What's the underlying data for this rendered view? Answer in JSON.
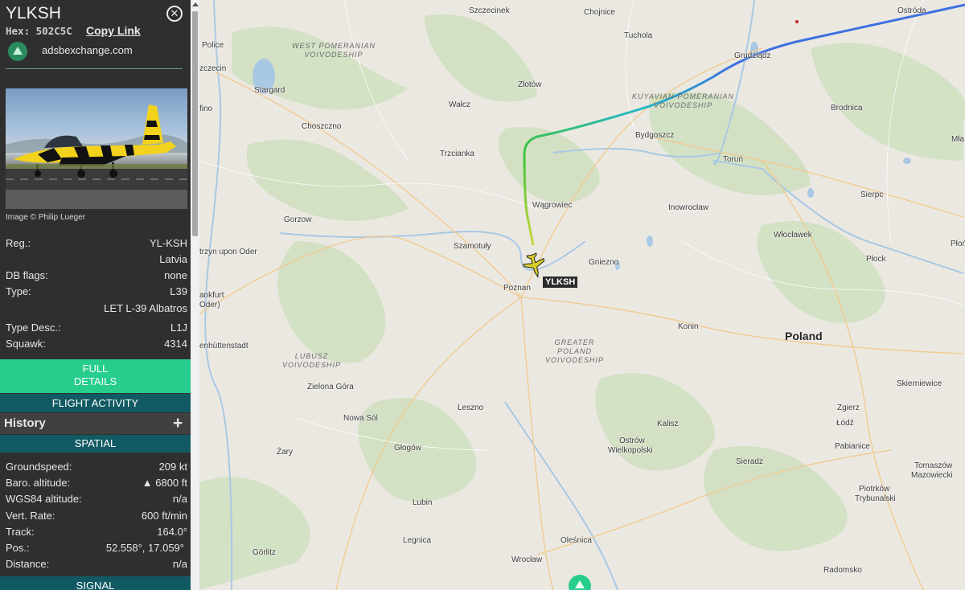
{
  "sidebar": {
    "title": "YLKSH",
    "hex_label": "Hex:",
    "hex_value": "502C5C",
    "copy_link": "Copy Link",
    "source_link": "adsbexchange.com",
    "photo_credit": "Image © Philip Lueger",
    "info": {
      "reg_label": "Reg.:",
      "reg_value": "YL-KSH",
      "country": "Latvia",
      "dbflags_label": "DB flags:",
      "dbflags_value": "none",
      "type_label": "Type:",
      "type_value": "L39",
      "type_full": "LET L-39 Albatros",
      "typedesc_label": "Type Desc.:",
      "typedesc_value": "L1J",
      "squawk_label": "Squawk:",
      "squawk_value": "4314"
    },
    "full_details_line1": "FULL",
    "full_details_line2": "DETAILS",
    "flight_activity": "FLIGHT ACTIVITY",
    "history": "History",
    "history_toggle": "+",
    "spatial_header": "SPATIAL",
    "spatial": {
      "groundspeed_label": "Groundspeed:",
      "groundspeed_value": "209 kt",
      "baro_label": "Baro. altitude:",
      "baro_value": "▲ 6800 ft",
      "wgs_label": "WGS84 altitude:",
      "wgs_value": "n/a",
      "vrate_label": "Vert. Rate:",
      "vrate_value": "600 ft/min",
      "track_label": "Track:",
      "track_value": "164.0°",
      "pos_label": "Pos.:",
      "pos_value": "52.558°, 17.059°",
      "distance_label": "Distance:",
      "distance_value": "n/a"
    },
    "signal_header": "SIGNAL"
  },
  "map": {
    "aircraft_label": "YLKSH",
    "country": "Poland",
    "regions": {
      "west_pomeranian": [
        "WEST POMERANIAN",
        "VOIVODESHIP"
      ],
      "kuyavian_pomeranian": [
        "KUYAVIAN-POMERANIAN",
        "VOIVODESHIP"
      ],
      "lubusz": [
        "LUBUSZ",
        "VOIVODESHIP"
      ],
      "greater_poland": [
        "GREATER",
        "POLAND",
        "VOIVODESHIP"
      ]
    },
    "cities": {
      "szczecinek": "Szczecinek",
      "chojnice": "Chojnice",
      "ostroda": "Ostróda",
      "police": "Police",
      "tuchola": "Tuchola",
      "grudziadz": "Grudziądz",
      "szczecin": "zczecin",
      "stargard": "Stargard",
      "zlotow": "Złotów",
      "walcz": "Wałcz",
      "brodnica": "Brodnica",
      "gryfino": "fino",
      "choszczno": "Choszczno",
      "bydgoszcz": "Bydgoszcz",
      "mlawa": "Mła",
      "trzcianka": "Trzcianka",
      "torun": "Toruń",
      "wagrowiec": "Wągrowiec",
      "inowroclaw": "Inowrocław",
      "sierpc": "Sierpc",
      "gorzow": "Gorzow",
      "wloclawek": "Włocławek",
      "szamotuly": "Szamotuły",
      "kostrzyn": "trzyn upon Oder",
      "gniezno": "Gniezno",
      "plock": "Płock",
      "plonsk": "Płoń",
      "poznan": "Poznan",
      "frankfurt": "ankfurt",
      "frankfurt2": "Oder)",
      "konin": "Konin",
      "eisenhuttenstadt": "enhüttenstadt",
      "zielona_gora": "Zielona Góra",
      "skierniewice": "Skierniewice",
      "leszno": "Leszno",
      "nowa_sol": "Nowa Sól",
      "zgierz": "Zgierz",
      "kalisz": "Kalisz",
      "lodz": "Łódź",
      "glogow": "Głogów",
      "ostrow": "Ostrów",
      "ostrow2": "Wielkopolski",
      "zary": "Żary",
      "pabianice": "Pabianice",
      "sieradz": "Sieradz",
      "tomaszow": "Tomaszów",
      "tomaszow2": "Mazowiecki",
      "lubin": "Lubin",
      "piotrkow": "Piotrków",
      "piotrkow2": "Trybunalski",
      "legnica": "Legnica",
      "olesnica": "Oleśnica",
      "gorlitz": "Görlitz",
      "wroclaw": "Wrocław",
      "radomsko": "Radomsko"
    }
  },
  "colors": {
    "accent_green": "#27cd8d",
    "header_teal": "#125a63",
    "track_blue": "#3d6fe0",
    "track_teal": "#25b6c9",
    "track_green": "#3fc63a",
    "aircraft_yellow": "#d8cf2a"
  },
  "icons": {
    "close": "close-circle-icon",
    "logo": "adsbexchange-logo-icon",
    "aircraft": "jet-aircraft-icon",
    "history_toggle": "plus-icon"
  }
}
